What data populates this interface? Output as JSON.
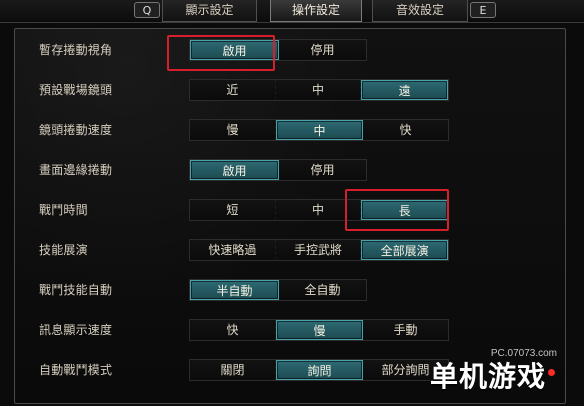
{
  "tabs": {
    "left_key": "Q",
    "right_key": "E",
    "items": [
      {
        "label": "顯示設定",
        "active": false
      },
      {
        "label": "操作設定",
        "active": true
      },
      {
        "label": "音效設定",
        "active": false
      }
    ]
  },
  "settings": [
    {
      "label": "暫存捲動視角",
      "options": [
        "啟用",
        "停用"
      ],
      "selected": 0,
      "highlight": true
    },
    {
      "label": "預設戰場鏡頭",
      "options": [
        "近",
        "中",
        "遠"
      ],
      "selected": 2,
      "highlight": false
    },
    {
      "label": "鏡頭捲動速度",
      "options": [
        "慢",
        "中",
        "快"
      ],
      "selected": 1,
      "highlight": false
    },
    {
      "label": "畫面邊緣捲動",
      "options": [
        "啟用",
        "停用"
      ],
      "selected": 0,
      "highlight": false
    },
    {
      "label": "戰鬥時間",
      "options": [
        "短",
        "中",
        "長"
      ],
      "selected": 2,
      "highlight": true
    },
    {
      "label": "技能展演",
      "options": [
        "快速略過",
        "手控武將",
        "全部展演"
      ],
      "selected": 2,
      "highlight": false
    },
    {
      "label": "戰鬥技能自動",
      "options": [
        "半自動",
        "全自動"
      ],
      "selected": 0,
      "highlight": false
    },
    {
      "label": "訊息顯示速度",
      "options": [
        "快",
        "慢",
        "手動"
      ],
      "selected": 1,
      "highlight": false
    },
    {
      "label": "自動戰鬥模式",
      "options": [
        "關閉",
        "詢問",
        "部分詢問"
      ],
      "selected": 1,
      "highlight": false
    }
  ],
  "watermark": {
    "site": "PC.07073.com",
    "brand": "单机游戏"
  },
  "colors": {
    "accent_teal": "#2d6a72",
    "highlight_red": "#d51f2a"
  }
}
